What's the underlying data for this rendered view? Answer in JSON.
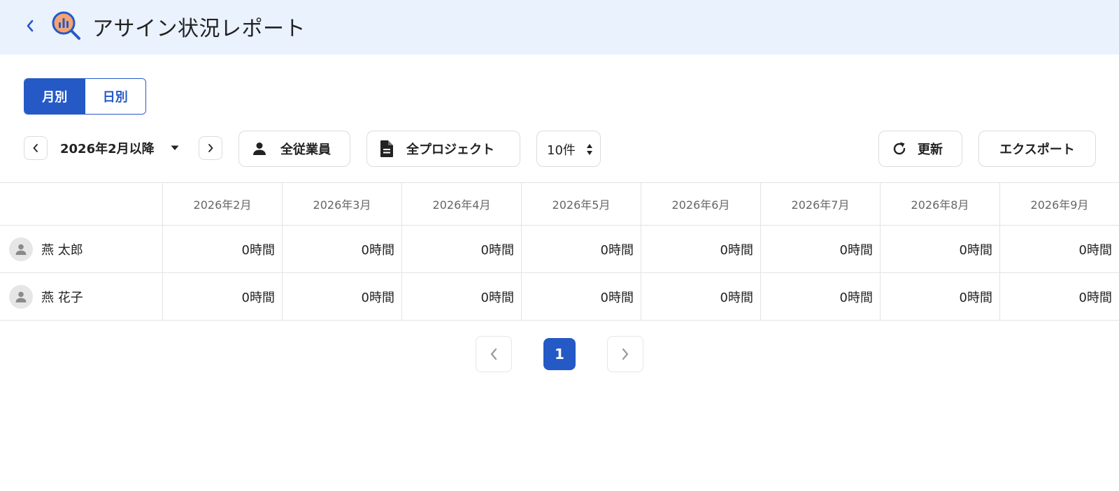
{
  "header": {
    "title": "アサイン状況レポート"
  },
  "view_toggle": {
    "monthly_label": "月別",
    "daily_label": "日別",
    "active": "monthly"
  },
  "toolbar": {
    "period_label": "2026年2月以降",
    "employee_filter_label": "全従業員",
    "project_filter_label": "全プロジェクト",
    "page_size_label": "10件",
    "refresh_label": "更新",
    "export_label": "エクスポート"
  },
  "table": {
    "columns": [
      "2026年2月",
      "2026年3月",
      "2026年4月",
      "2026年5月",
      "2026年6月",
      "2026年7月",
      "2026年8月",
      "2026年9月"
    ],
    "rows": [
      {
        "name": "燕 太郎",
        "values": [
          "0時間",
          "0時間",
          "0時間",
          "0時間",
          "0時間",
          "0時間",
          "0時間",
          "0時間"
        ]
      },
      {
        "name": "燕 花子",
        "values": [
          "0時間",
          "0時間",
          "0時間",
          "0時間",
          "0時間",
          "0時間",
          "0時間",
          "0時間"
        ]
      }
    ]
  },
  "pagination": {
    "current_page": "1"
  },
  "colors": {
    "accent": "#2559c6",
    "header_bg": "#eaf2fe",
    "logo_orange": "#f4a373",
    "logo_blue": "#2559c6"
  },
  "icons": {
    "back": "chevron-left-icon",
    "logo": "report-search-icon",
    "employee": "person-icon",
    "project": "document-icon",
    "refresh": "refresh-icon",
    "avatar": "person-icon"
  }
}
